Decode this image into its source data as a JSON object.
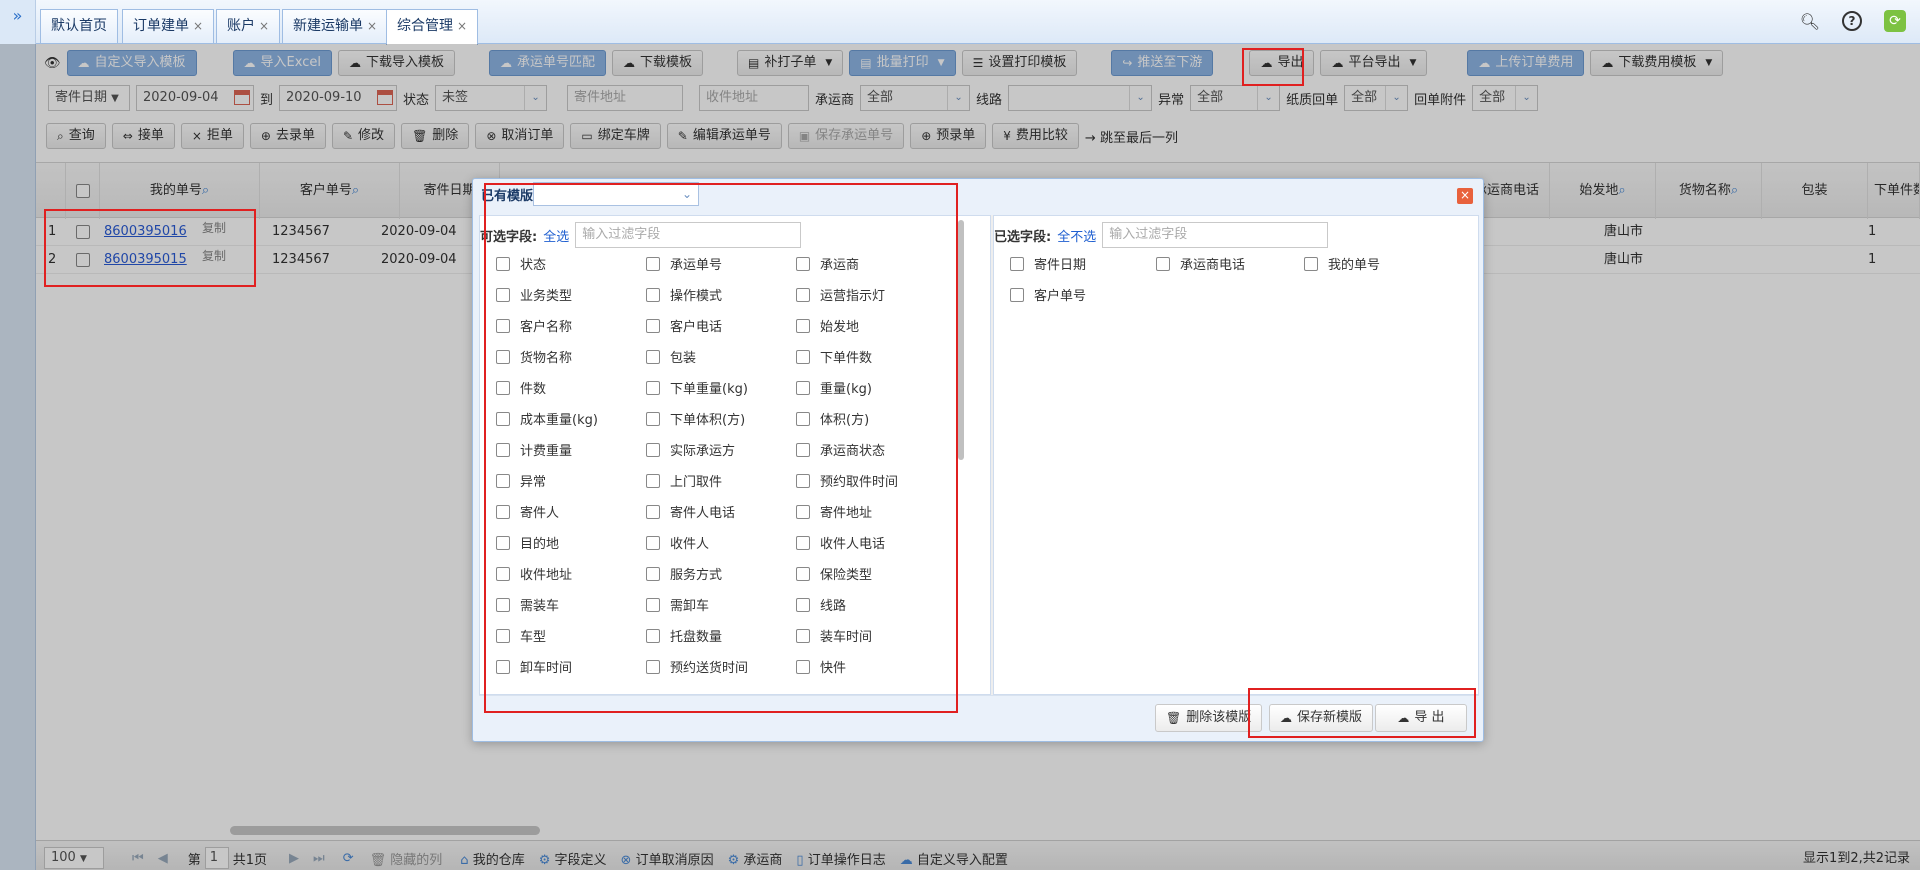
{
  "tabs": [
    {
      "label": "默认首页",
      "closable": false
    },
    {
      "label": "订单建单",
      "closable": true
    },
    {
      "label": "账户",
      "closable": true
    },
    {
      "label": "新建运输单",
      "closable": true
    },
    {
      "label": "综合管理",
      "closable": true,
      "active": true
    }
  ],
  "top_icons": [
    "search-icon",
    "help-icon",
    "refresh-icon"
  ],
  "toolbar1": {
    "btns": [
      "自定义导入模板",
      "导入Excel",
      "下载导入模板",
      "承运单号匹配",
      "下载模板",
      "补打子单",
      "批量打印",
      "设置打印模板",
      "推送至下游",
      "导出",
      "平台导出",
      "上传订单费用",
      "下载费用模板"
    ]
  },
  "filters": {
    "date_type": "寄件日期",
    "date_from": "2020-09-04",
    "to_label": "到",
    "date_to": "2020-09-10",
    "status_label": "状态",
    "status_value": "未签",
    "sender_addr_ph": "寄件地址",
    "recv_addr_ph": "收件地址",
    "carrier_label": "承运商",
    "carrier_value": "全部",
    "route_label": "线路",
    "route_value": "",
    "abnormal_label": "异常",
    "abnormal_value": "全部",
    "paper_label": "纸质回单",
    "paper_value": "全部",
    "receipt_label": "回单附件",
    "receipt_value": "全部"
  },
  "toolbar3": {
    "btns": [
      "查询",
      "接单",
      "拒单",
      "去录单",
      "修改",
      "删除",
      "取消订单",
      "绑定车牌",
      "编辑承运单号",
      "保存承运单号",
      "预录单",
      "费用比较",
      "跳至最后一列"
    ]
  },
  "grid": {
    "headers": {
      "my_no": "我的单号",
      "cust_no": "客户单号",
      "send_date": "寄件日期",
      "carrier_phone": "承运商电话",
      "origin": "始发地",
      "goods": "货物名称",
      "pack": "包装",
      "qty": "下单件数"
    },
    "rows": [
      {
        "idx": "1",
        "my_no": "8600395016",
        "copy": "复制",
        "cust_no": "1234567",
        "send_date": "2020-09-04",
        "origin": "唐山市",
        "qty": "1"
      },
      {
        "idx": "2",
        "my_no": "8600395015",
        "copy": "复制",
        "cust_no": "1234567",
        "send_date": "2020-09-04",
        "origin": "唐山市",
        "qty": "1"
      }
    ]
  },
  "pager": {
    "page_size": "100",
    "page_label": "第",
    "page_num": "1",
    "total_pages": "共1页",
    "links": [
      "隐藏的列",
      "我的仓库",
      "字段定义",
      "订单取消原因",
      "承运商",
      "订单操作日志",
      "自定义导入配置"
    ],
    "summary": "显示1到2,共2记录"
  },
  "modal": {
    "title": "已有模版",
    "left_label": "可选字段:",
    "select_all": "全选",
    "filter_ph": "输入过滤字段",
    "fields": [
      "状态",
      "承运单号",
      "承运商",
      "业务类型",
      "操作模式",
      "运营指示灯",
      "客户名称",
      "客户电话",
      "始发地",
      "货物名称",
      "包装",
      "下单件数",
      "件数",
      "下单重量(kg)",
      "重量(kg)",
      "成本重量(kg)",
      "下单体积(方)",
      "体积(方)",
      "计费重量",
      "实际承运方",
      "承运商状态",
      "异常",
      "上门取件",
      "预约取件时间",
      "寄件人",
      "寄件人电话",
      "寄件地址",
      "目的地",
      "收件人",
      "收件人电话",
      "收件地址",
      "服务方式",
      "保险类型",
      "需装车",
      "需卸车",
      "线路",
      "车型",
      "托盘数量",
      "装车时间",
      "卸车时间",
      "预约送货时间",
      "快件"
    ],
    "right_label": "已选字段:",
    "select_none": "全不选",
    "selected": [
      "寄件日期",
      "承运商电话",
      "我的单号",
      "客户单号"
    ],
    "delete_btn": "删除该模版",
    "save_btn": "保存新模版",
    "export_btn": "导 出"
  },
  "colors": {
    "highlight": "#e02020",
    "accent_blue": "#8fb6e6",
    "link": "#2a5bd7"
  }
}
